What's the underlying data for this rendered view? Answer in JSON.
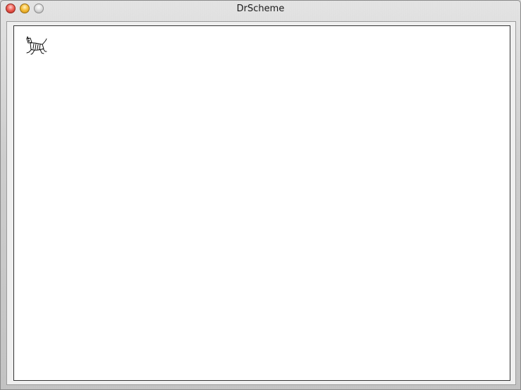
{
  "window": {
    "title": "DrScheme"
  },
  "titlebar": {
    "buttons": [
      {
        "name": "close",
        "icon": "close-icon",
        "color": "#f0645a"
      },
      {
        "name": "minimize",
        "icon": "minimize-icon",
        "color": "#f7c03e"
      },
      {
        "name": "zoom",
        "icon": "zoom-icon",
        "color": "#dcdcdc"
      }
    ]
  },
  "canvas": {
    "background": "#ffffff",
    "sprite": {
      "icon": "cat-icon"
    }
  }
}
